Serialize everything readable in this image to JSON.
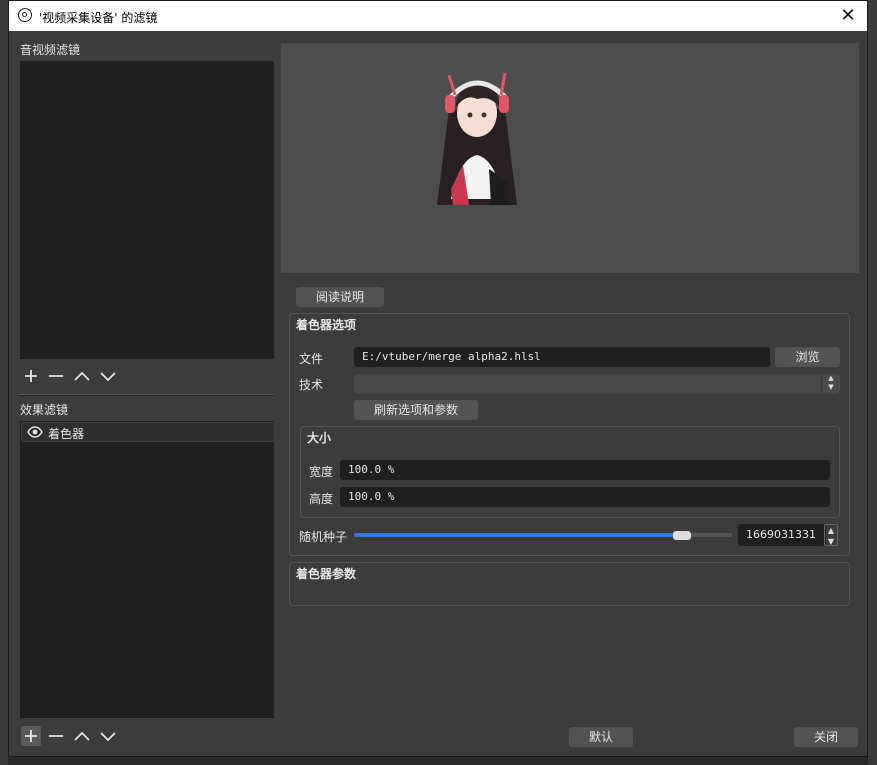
{
  "window": {
    "title": "'视频采集设备' 的滤镜",
    "close_symbol": "✕"
  },
  "left_panel": {
    "audio_video_filters_label": "音视频滤镜",
    "effect_filters_label": "效果滤镜",
    "effect_filters": [
      {
        "name": "着色器",
        "visible_icon": "eye-icon"
      }
    ],
    "toolbar_icons": [
      "plus-icon",
      "minus-icon",
      "chevron-up-icon",
      "chevron-down-icon"
    ]
  },
  "main": {
    "read_instructions_button": "阅读说明",
    "shader_options": {
      "title": "着色器选项",
      "file_label": "文件",
      "file_value": "E:/vtuber/merge alpha2.hlsl",
      "browse_button": "浏览",
      "technique_label": "技术",
      "technique_value": "",
      "refresh_button": "刷新选项和参数",
      "size_group": {
        "title": "大小",
        "width_label": "宽度",
        "width_value": "100.0 %",
        "height_label": "高度",
        "height_value": "100.0 %"
      },
      "random_seed_label": "随机种子",
      "random_seed_value": "1669031331",
      "random_seed_slider_fraction": 0.88
    },
    "shader_params": {
      "title": "着色器参数"
    }
  },
  "footer": {
    "default_button": "默认",
    "close_button": "关闭"
  },
  "colors": {
    "accent": "#2f7bd9",
    "window_bg": "#3c3c3c",
    "list_bg": "#1f1f1f",
    "preview_bg": "#4d4d4d"
  }
}
